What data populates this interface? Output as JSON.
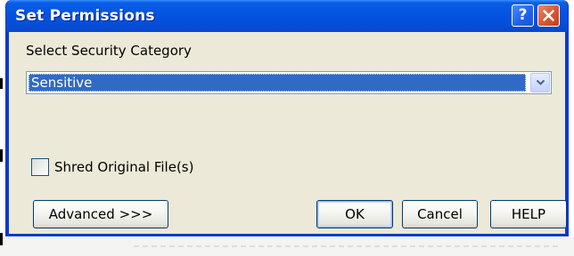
{
  "window": {
    "title": "Set Permissions",
    "help_icon": "question-mark-icon",
    "close_icon": "close-x-icon"
  },
  "category": {
    "label": "Select Security Category",
    "selected_value": "Sensitive",
    "dropdown_icon": "chevron-down-icon"
  },
  "shred": {
    "label": "Shred Original File(s)",
    "checked": false
  },
  "buttons": {
    "advanced": "Advanced >>>",
    "ok": "OK",
    "cancel": "Cancel",
    "help": "HELP"
  },
  "colors": {
    "titlebar": "#0454e0",
    "client_bg": "#ece9d8",
    "selection": "#316ac5",
    "close_button": "#d9542f"
  }
}
